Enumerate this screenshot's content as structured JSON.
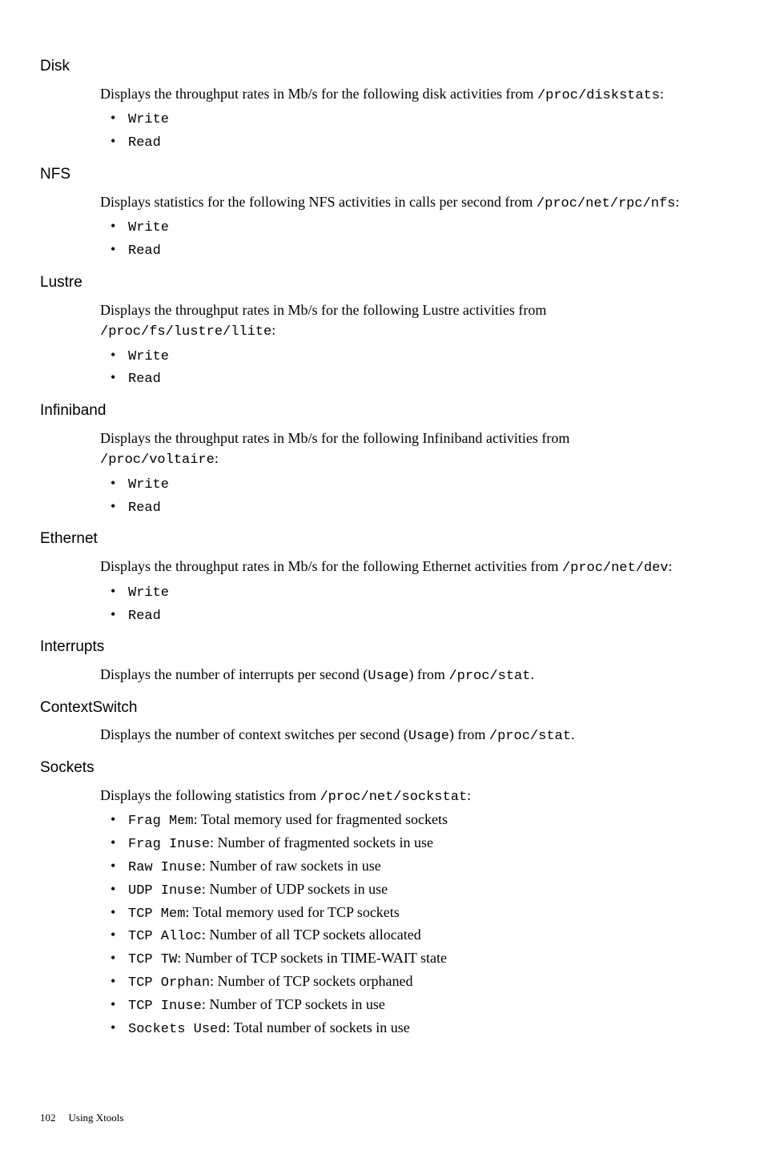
{
  "sections": {
    "disk": {
      "heading": "Disk",
      "desc_pre": "Displays the throughput rates in Mb/s for the following disk activities from ",
      "path": "/proc/diskstats",
      "desc_post": ":",
      "bullets": [
        "Write",
        "Read"
      ]
    },
    "nfs": {
      "heading": "NFS",
      "desc_pre": "Displays statistics for the following NFS activities in calls per second from ",
      "path": "/proc/net/rpc/nfs",
      "desc_post": ":",
      "bullets": [
        "Write",
        "Read"
      ]
    },
    "lustre": {
      "heading": "Lustre",
      "desc_pre": "Displays the throughput rates in Mb/s for the following Lustre activities from ",
      "path": "/proc/fs/lustre/llite",
      "desc_post": ":",
      "bullets": [
        "Write",
        "Read"
      ]
    },
    "infiniband": {
      "heading": "Infiniband",
      "desc_pre": "Displays the throughput rates in Mb/s for the following Infiniband activities from ",
      "path": "/proc/voltaire",
      "desc_post": ":",
      "bullets": [
        "Write",
        "Read"
      ]
    },
    "ethernet": {
      "heading": "Ethernet",
      "desc_pre": "Displays the throughput rates in Mb/s for the following Ethernet activities from ",
      "path": "/proc/net/dev",
      "desc_post": ":",
      "bullets": [
        "Write",
        "Read"
      ]
    },
    "interrupts": {
      "heading": "Interrupts",
      "desc_pre": "Displays the number of interrupts per second (",
      "usage": "Usage",
      "desc_mid": ") from ",
      "path": "/proc/stat",
      "desc_post": "."
    },
    "contextswitch": {
      "heading": "ContextSwitch",
      "desc_pre": "Displays the number of context switches per second (",
      "usage": "Usage",
      "desc_mid": ") from ",
      "path": "/proc/stat",
      "desc_post": "."
    },
    "sockets": {
      "heading": "Sockets",
      "desc_pre": "Displays the following statistics from ",
      "path": "/proc/net/sockstat",
      "desc_post": ":",
      "items": [
        {
          "label": "Frag Mem",
          "text": ": Total memory used for fragmented sockets"
        },
        {
          "label": "Frag Inuse",
          "text": ": Number of fragmented sockets in use"
        },
        {
          "label": "Raw Inuse",
          "text": ": Number of raw sockets in use"
        },
        {
          "label": "UDP Inuse",
          "text": ": Number of UDP sockets in use"
        },
        {
          "label": "TCP Mem",
          "text": ": Total memory used for TCP sockets"
        },
        {
          "label": "TCP Alloc",
          "text": ": Number of all TCP sockets allocated"
        },
        {
          "label": "TCP TW",
          "text": ": Number of TCP sockets in TIME-WAIT state"
        },
        {
          "label": "TCP Orphan",
          "text": ": Number of TCP sockets orphaned"
        },
        {
          "label": "TCP Inuse",
          "text": ": Number of TCP sockets in use"
        },
        {
          "label": "Sockets Used",
          "text": ": Total number of sockets in use"
        }
      ]
    }
  },
  "footer": {
    "page": "102",
    "title": "Using Xtools"
  }
}
